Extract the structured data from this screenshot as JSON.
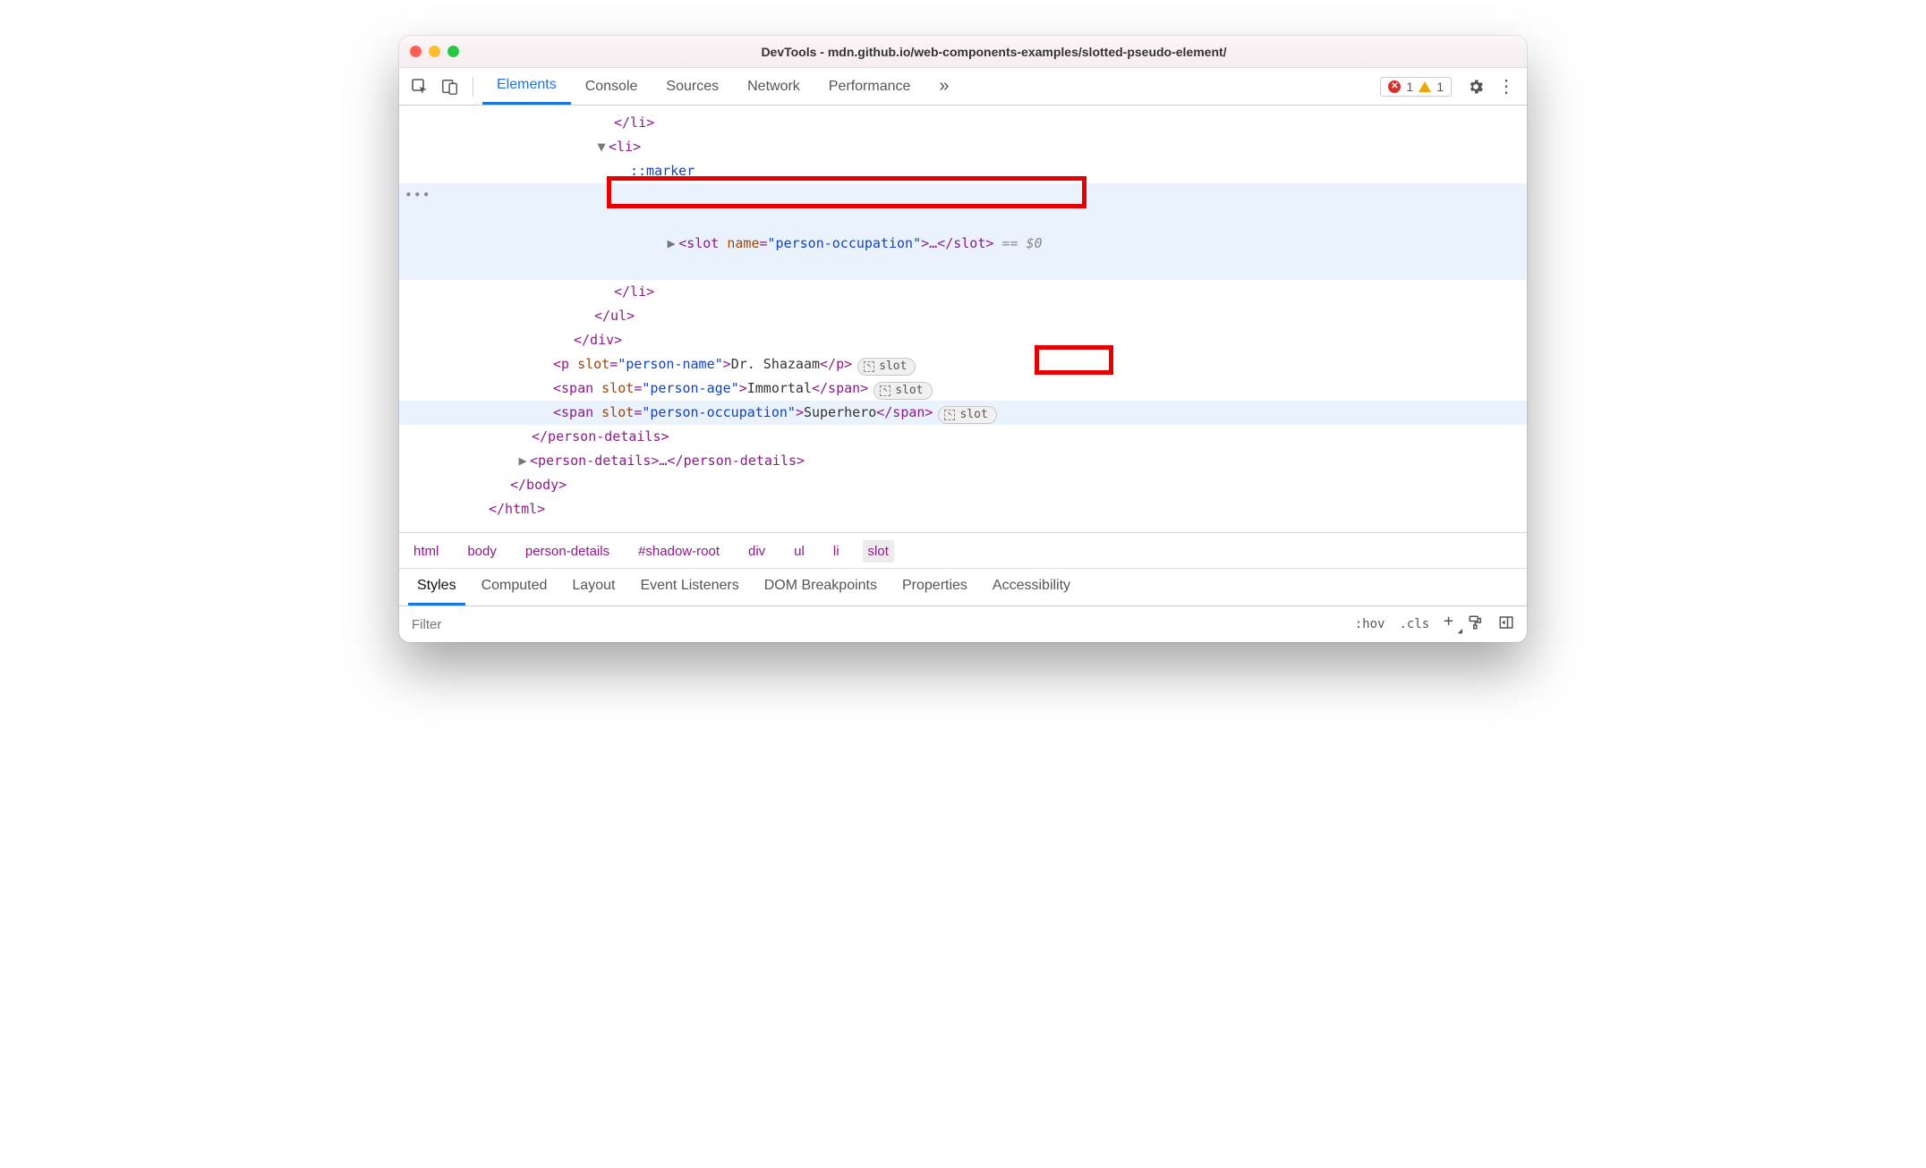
{
  "window": {
    "title": "DevTools - mdn.github.io/web-components-examples/slotted-pseudo-element/"
  },
  "tabs": {
    "elements": "Elements",
    "console": "Console",
    "sources": "Sources",
    "network": "Network",
    "performance": "Performance"
  },
  "issues": {
    "errors": "1",
    "warnings": "1"
  },
  "tree": {
    "li_close1": "</li>",
    "li_open": "<li>",
    "marker": "::marker",
    "slot_open": "<slot",
    "slot_attr_name": " name",
    "slot_eq": "=",
    "slot_attr_val": "\"person-occupation\"",
    "slot_after": ">…</slot>",
    "eq0": " == $0",
    "li_close2": "</li>",
    "ul_close": "</ul>",
    "div_close": "</div>",
    "p_line_open": "<p",
    "p_attr": " slot",
    "p_val": "\"person-name\"",
    "p_text": "Dr. Shazaam",
    "p_close": "</p>",
    "span1_open": "<span",
    "span1_attr": " slot",
    "span1_val": "\"person-age\"",
    "span1_text": "Immortal",
    "span1_close": "</span>",
    "span2_open": "<span",
    "span2_attr": " slot",
    "span2_val": "\"person-occupation\"",
    "span2_text": "Superhero",
    "span2_close": "</span>",
    "pd_close": "</person-details>",
    "pd2": "<person-details>…</person-details>",
    "body_close": "</body>",
    "html_close": "</html>",
    "slot_badge": "slot",
    "ellipsis_gutter": "•••"
  },
  "crumbs": [
    "html",
    "body",
    "person-details",
    "#shadow-root",
    "div",
    "ul",
    "li",
    "slot"
  ],
  "subtabs": [
    "Styles",
    "Computed",
    "Layout",
    "Event Listeners",
    "DOM Breakpoints",
    "Properties",
    "Accessibility"
  ],
  "filter": {
    "placeholder": "Filter",
    "hov": ":hov",
    "cls": ".cls"
  }
}
